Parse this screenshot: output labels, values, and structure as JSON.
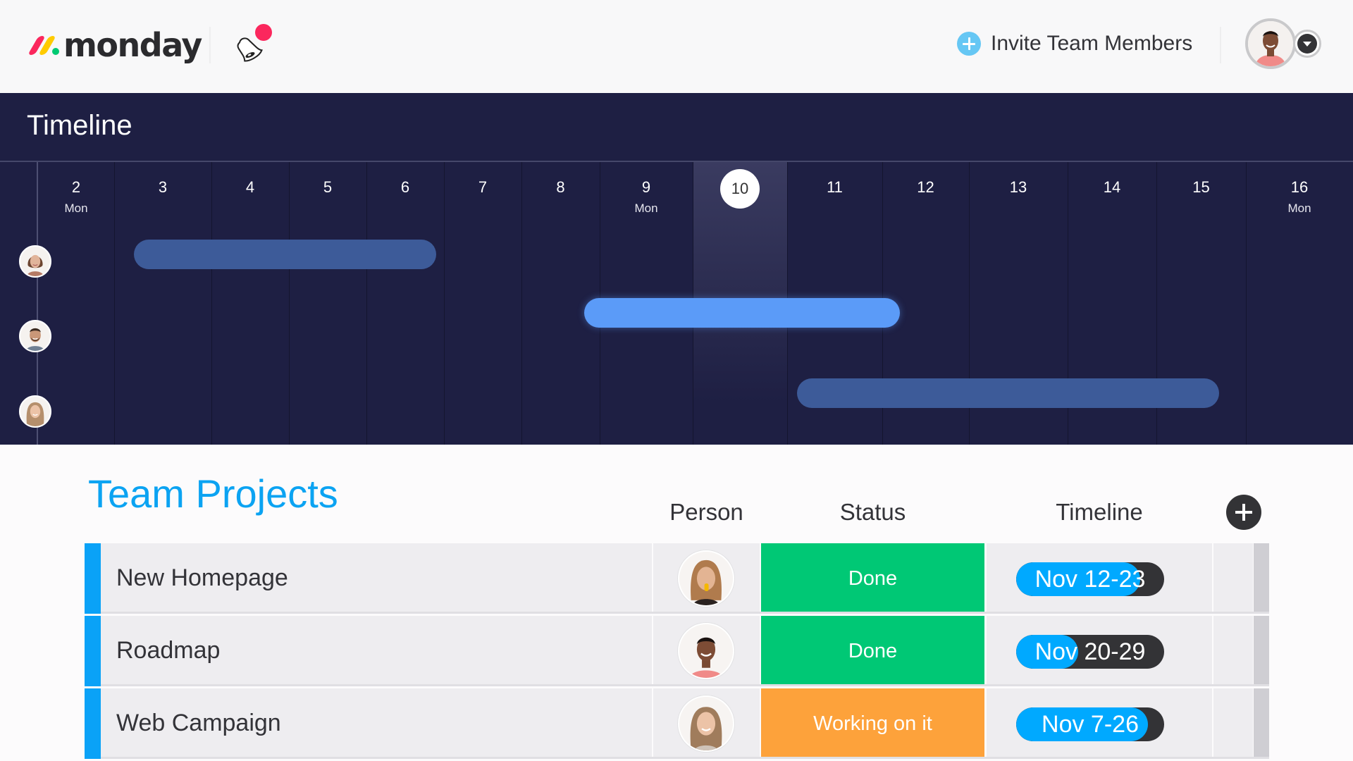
{
  "topbar": {
    "logo_text": "monday",
    "notification_dot_color": "#fb275d",
    "invite_label": "Invite Team Members",
    "invite_icon": "plus-circle-icon",
    "user_menu_icon": "caret-down-icon"
  },
  "timeline": {
    "title": "Timeline",
    "today": "10",
    "days": [
      {
        "num": "2",
        "weekday": "Mon"
      },
      {
        "num": "3",
        "weekday": ""
      },
      {
        "num": "4",
        "weekday": ""
      },
      {
        "num": "5",
        "weekday": ""
      },
      {
        "num": "6",
        "weekday": ""
      },
      {
        "num": "7",
        "weekday": ""
      },
      {
        "num": "8",
        "weekday": ""
      },
      {
        "num": "9",
        "weekday": "Mon"
      },
      {
        "num": "10",
        "weekday": ""
      },
      {
        "num": "11",
        "weekday": ""
      },
      {
        "num": "12",
        "weekday": ""
      },
      {
        "num": "13",
        "weekday": ""
      },
      {
        "num": "14",
        "weekday": ""
      },
      {
        "num": "15",
        "weekday": ""
      },
      {
        "num": "16",
        "weekday": "Mon"
      }
    ],
    "bars": [
      {
        "person": "woman-1",
        "start_day": 3.2,
        "end_day": 6.9,
        "color": "#3d5b99"
      },
      {
        "person": "man-1",
        "start_day": 8.8,
        "end_day": 12.2,
        "color": "#5b9bf8"
      },
      {
        "person": "woman-2",
        "start_day": 11.1,
        "end_day": 15.7,
        "color": "#3d5b99"
      }
    ]
  },
  "projects": {
    "title": "Team Projects",
    "columns": {
      "person": "Person",
      "status": "Status",
      "timeline": "Timeline"
    },
    "add_column_icon": "plus-icon",
    "rows": [
      {
        "name": "New Homepage",
        "person": "woman-3",
        "status": "Done",
        "status_color": "#00c875",
        "timeline": "Nov 12-23",
        "timeline_progress": 0.84
      },
      {
        "name": "Roadmap",
        "person": "man-2",
        "status": "Done",
        "status_color": "#00c875",
        "timeline": "Nov 20-29",
        "timeline_progress": 0.42
      },
      {
        "name": "Web Campaign",
        "person": "woman-2",
        "status": "Working on it",
        "status_color": "#fda23b",
        "timeline": "Nov 7-26",
        "timeline_progress": 0.89
      }
    ]
  },
  "colors": {
    "brand_blue": "#0aa2f7",
    "timeline_bg": "#1e1f43",
    "done": "#00c875",
    "working": "#fda23b"
  }
}
